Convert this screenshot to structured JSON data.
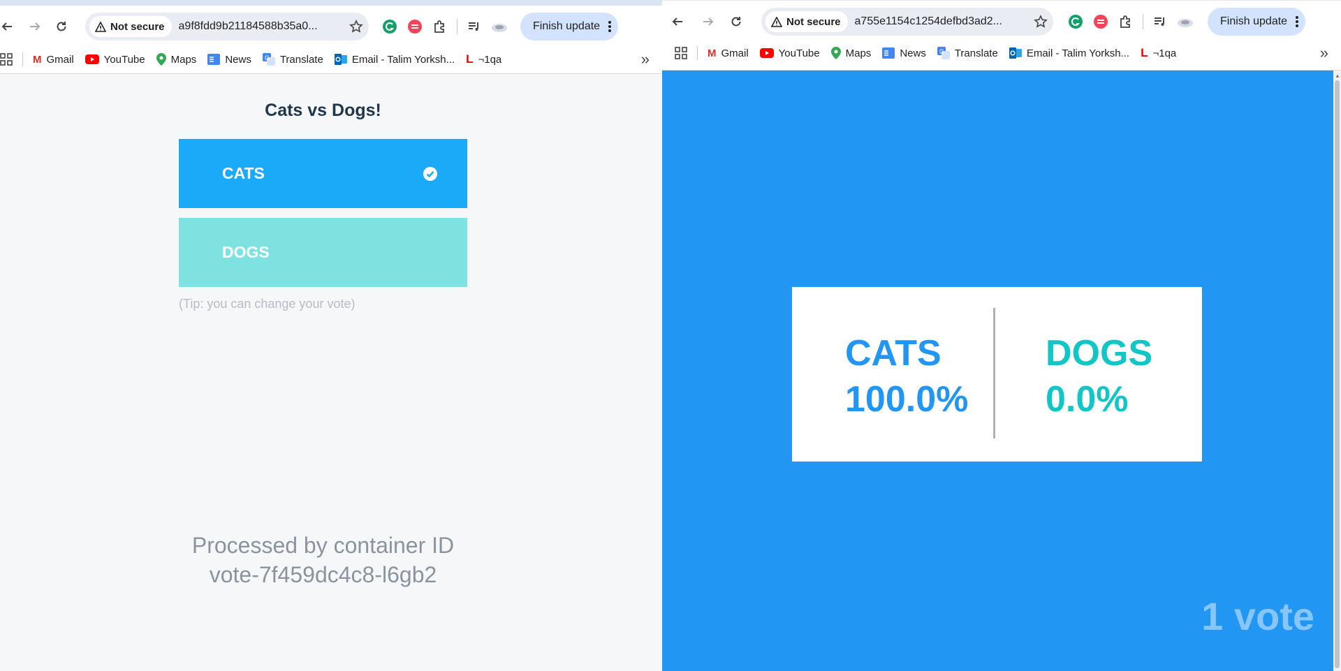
{
  "left_window": {
    "toolbar": {
      "security_label": "Not secure",
      "url": "a9f8fdd9b21184588b35a0...",
      "update_label": "Finish update"
    },
    "bookmarks": [
      "Gmail",
      "YouTube",
      "Maps",
      "News",
      "Translate",
      "Email - Talim Yorksh...",
      "¬1qa"
    ],
    "page": {
      "title": "Cats vs Dogs!",
      "option_a": "CATS",
      "option_b": "DOGS",
      "selected": "CATS",
      "tip": "(Tip: you can change your vote)",
      "processed_label": "Processed by container ID",
      "container_id": "vote-7f459dc4c8-l6gb2"
    }
  },
  "right_window": {
    "toolbar": {
      "security_label": "Not secure",
      "url": "a755e1154c1254defbd3ad2...",
      "update_label": "Finish update"
    },
    "bookmarks": [
      "Gmail",
      "YouTube",
      "Maps",
      "News",
      "Translate",
      "Email - Talim Yorksh...",
      "¬1qa"
    ],
    "page": {
      "cats_label": "CATS",
      "cats_percent": "100.0%",
      "dogs_label": "DOGS",
      "dogs_percent": "0.0%",
      "vote_count": "1 vote"
    }
  },
  "colors": {
    "cats_button": "#1aaaf8",
    "dogs_button": "#7ee3e0",
    "result_background": "#2196f3",
    "cats_text": "#2196f3",
    "dogs_text": "#13c6c6"
  },
  "icons": {
    "back": "arrow-left-icon",
    "forward": "arrow-right-icon",
    "reload": "reload-icon",
    "warning": "warning-triangle-icon",
    "bookmark_star": "star-icon",
    "grammarly": "grammarly-icon",
    "extension2": "red-circle-extension-icon",
    "extensions": "puzzle-icon",
    "media": "media-queue-icon",
    "profile": "profile-avatar-icon",
    "menu": "kebab-menu-icon",
    "apps": "apps-grid-icon",
    "selected_check": "check-circle-icon",
    "more_bookmarks": "chevron-double-right-icon"
  }
}
